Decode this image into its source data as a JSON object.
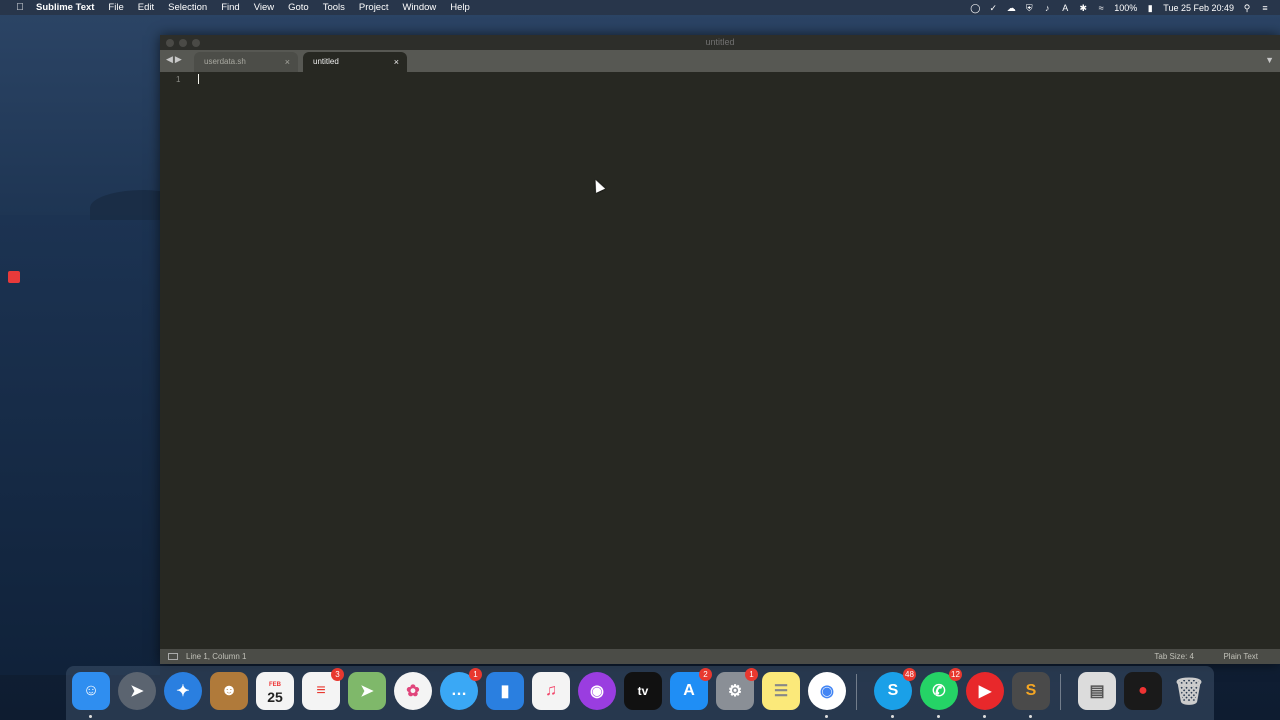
{
  "menubar": {
    "app_name": "Sublime Text",
    "items": [
      "File",
      "Edit",
      "Selection",
      "Find",
      "View",
      "Goto",
      "Tools",
      "Project",
      "Window",
      "Help"
    ],
    "battery": "100%",
    "datetime": "Tue 25 Feb  20:49"
  },
  "window": {
    "title": "untitled",
    "tabs": [
      {
        "label": "userdata.sh",
        "active": false
      },
      {
        "label": "untitled",
        "active": true
      }
    ],
    "line_number": "1",
    "status": {
      "position": "Line 1, Column 1",
      "tab_size": "Tab Size: 4",
      "syntax": "Plain Text"
    }
  },
  "dock": {
    "calendar_month": "FEB",
    "calendar_day": "25",
    "badges": {
      "reminders": "3",
      "messages": "1",
      "app_store": "2",
      "system_prefs": "1",
      "skype": "48",
      "whatsapp": "12"
    },
    "tv_label": "tv"
  },
  "colors": {
    "editor_bg": "#272822",
    "tab_bar": "#575853",
    "status_bar": "#4b4c47"
  }
}
